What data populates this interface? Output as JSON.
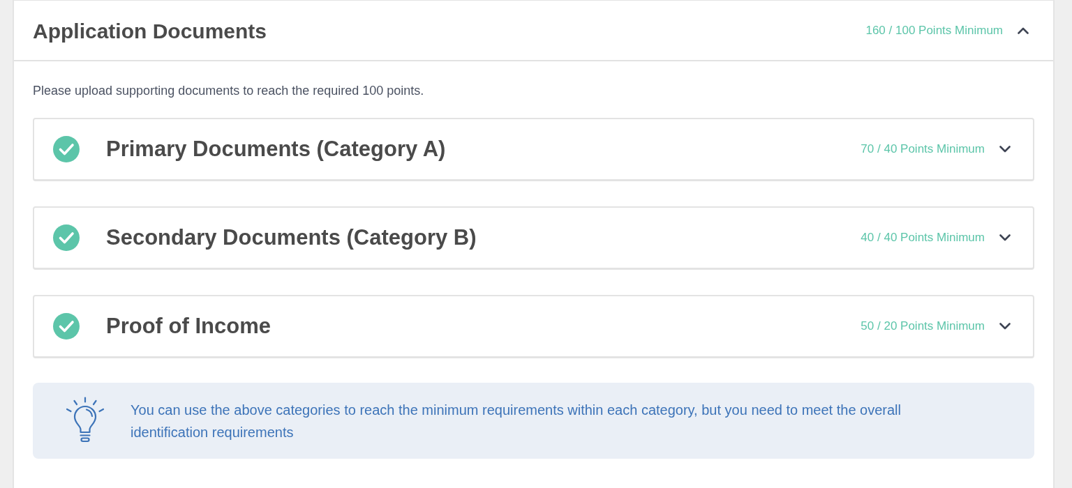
{
  "panel": {
    "title": "Application Documents",
    "points": "160 / 100 Points Minimum",
    "expanded": true
  },
  "intro": "Please upload supporting documents to reach the required 100 points.",
  "sections": [
    {
      "title": "Primary Documents (Category A)",
      "points": "70 / 40 Points Minimum",
      "complete": true,
      "expanded": false
    },
    {
      "title": "Secondary Documents (Category B)",
      "points": "40 / 40 Points Minimum",
      "complete": true,
      "expanded": false
    },
    {
      "title": "Proof of Income",
      "points": "50 / 20 Points Minimum",
      "complete": true,
      "expanded": false
    }
  ],
  "tip": {
    "text": "You can use the above categories to reach the minimum requirements within each category, but you need to meet the overall identification requirements"
  }
}
